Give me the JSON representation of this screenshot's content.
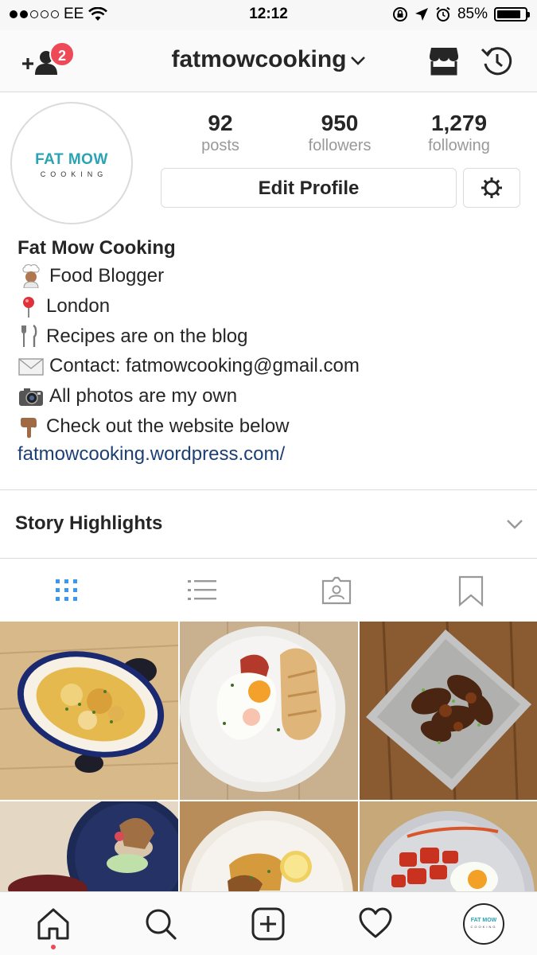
{
  "status_bar": {
    "carrier": "EE",
    "time": "12:12",
    "battery": "85%",
    "battery_fraction": 0.85
  },
  "nav": {
    "username": "fatmowcooking",
    "notification_count": "2"
  },
  "avatar": {
    "logo_main": "FAT MOW",
    "logo_sub": "COOKING"
  },
  "stats": [
    {
      "value": "92",
      "label": "posts"
    },
    {
      "value": "950",
      "label": "followers"
    },
    {
      "value": "1,279",
      "label": "following"
    }
  ],
  "actions": {
    "edit_profile": "Edit Profile"
  },
  "bio": {
    "name": "Fat Mow Cooking",
    "lines": [
      {
        "icon": "chef-emoji-icon",
        "text": "Food Blogger"
      },
      {
        "icon": "round-pushpin-icon",
        "text": "London"
      },
      {
        "icon": "fork-knife-icon",
        "text": "Recipes are on the blog"
      },
      {
        "icon": "envelope-icon",
        "text": "Contact: fatmowcooking@gmail.com"
      },
      {
        "icon": "camera-icon",
        "text": "All photos are my own"
      },
      {
        "icon": "pointing-down-icon",
        "text": "Check out the website below"
      }
    ],
    "link": "fatmowcooking.wordpress.com/"
  },
  "highlights": {
    "title": "Story Highlights"
  },
  "view_tabs": [
    "grid-icon",
    "list-icon",
    "tagged-icon",
    "saved-icon"
  ],
  "active_view_tab": "grid-icon",
  "tab_bar": [
    "home-icon",
    "search-icon",
    "add-post-icon",
    "activity-heart-icon",
    "profile-avatar"
  ],
  "colors": {
    "accent_blue": "#3897f0",
    "badge_red": "#ed4956",
    "link": "#1e3f74",
    "logo_teal": "#2aa3b4"
  }
}
